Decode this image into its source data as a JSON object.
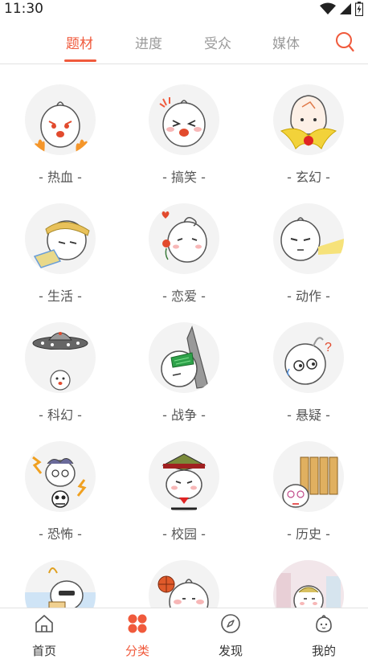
{
  "status": {
    "time": "11:30"
  },
  "tabs": [
    {
      "label": "题材",
      "active": true
    },
    {
      "label": "进度",
      "active": false
    },
    {
      "label": "受众",
      "active": false
    },
    {
      "label": "媒体",
      "active": false
    }
  ],
  "accent_color": "#f05a3c",
  "categories": [
    {
      "label": "- 热血 -"
    },
    {
      "label": "- 搞笑 -"
    },
    {
      "label": "- 玄幻 -"
    },
    {
      "label": "- 生活 -"
    },
    {
      "label": "- 恋爱 -"
    },
    {
      "label": "- 动作 -"
    },
    {
      "label": "- 科幻 -"
    },
    {
      "label": "- 战争 -"
    },
    {
      "label": "- 悬疑 -"
    },
    {
      "label": "- 恐怖 -"
    },
    {
      "label": "- 校园 -"
    },
    {
      "label": "- 历史 -"
    },
    {
      "label": ""
    },
    {
      "label": ""
    },
    {
      "label": ""
    }
  ],
  "bottom_nav": [
    {
      "label": "首页",
      "icon": "home-icon",
      "active": false
    },
    {
      "label": "分类",
      "icon": "category-icon",
      "active": true
    },
    {
      "label": "发现",
      "icon": "compass-icon",
      "active": false
    },
    {
      "label": "我的",
      "icon": "profile-icon",
      "active": false
    }
  ]
}
